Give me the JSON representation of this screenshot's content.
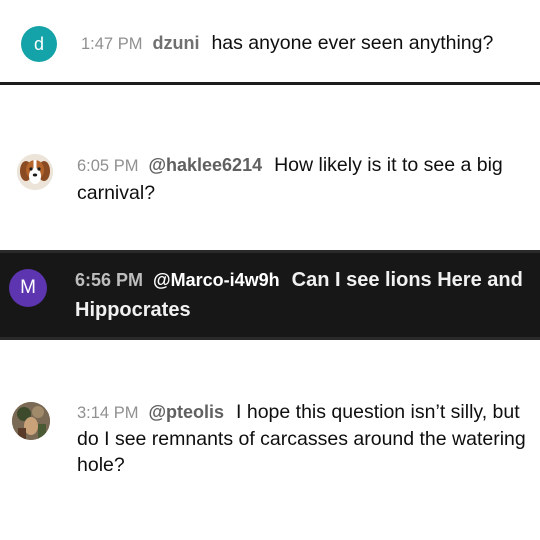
{
  "messages": [
    {
      "avatar_letter": "d",
      "avatar_color": "#14a3a8",
      "time": "1:47 PM",
      "author": "dzuni",
      "text": "has anyone ever seen anything?"
    },
    {
      "avatar_icon": "dog-avatar",
      "time": "6:05 PM",
      "author": "@haklee6214",
      "text": "How likely is it to see a big carnival?"
    },
    {
      "avatar_letter": "M",
      "avatar_color": "#5e35b1",
      "highlighted": true,
      "time": "6:56 PM",
      "author": "@Marco-i4w9h",
      "text": "Can I see lions Here and Hippocrates"
    },
    {
      "avatar_icon": "photo-avatar",
      "time": "3:14 PM",
      "author": "@pteolis",
      "text": "I hope this question isn’t silly, but do I see remnants of carcasses around the watering hole?"
    }
  ]
}
